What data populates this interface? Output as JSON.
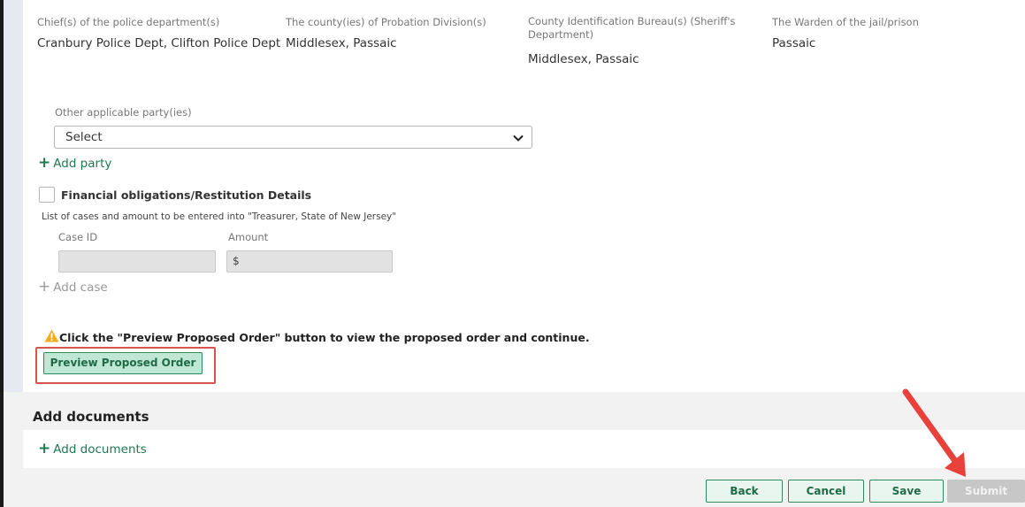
{
  "agencies": [
    {
      "label": "Chief(s) of the police department(s)",
      "value": "Cranbury Police Dept, Clifton Police Dept"
    },
    {
      "label": "The county(ies) of Probation Division(s)",
      "value": "Middlesex, Passaic"
    },
    {
      "label": "County Identification Bureau(s) (Sheriff's Department)",
      "value": "Middlesex, Passaic"
    },
    {
      "label": "The Warden of the jail/prison",
      "value": "Passaic"
    }
  ],
  "other_parties": {
    "label": "Other applicable party(ies)",
    "selected": "Select",
    "add_label": "Add party"
  },
  "financial": {
    "checkbox_label": "Financial obligations/Restitution Details",
    "checked": false,
    "description": "List of cases and amount to be entered into \"Treasurer, State of New Jersey\"",
    "case_id_label": "Case ID",
    "case_id_value": "",
    "amount_label": "Amount",
    "amount_prefix": "$",
    "amount_value": "",
    "add_case_label": "Add case"
  },
  "preview": {
    "instruction": "Click the \"Preview Proposed Order\" button to view the proposed order and continue.",
    "button_label": "Preview Proposed Order"
  },
  "documents": {
    "title": "Add documents",
    "add_label": "Add documents"
  },
  "footer": {
    "back": "Back",
    "cancel": "Cancel",
    "save": "Save",
    "submit": "Submit"
  },
  "icons": {
    "add": "plus-icon",
    "dropdown": "chevron-down-icon",
    "warning": "warning-icon",
    "annotation": "red-arrow-annotation"
  },
  "colors": {
    "accent_green": "#1f7a50",
    "button_fill": "#bfe7d4",
    "highlight_red": "#d9534f",
    "warning_yellow": "#f0ad1e",
    "disabled_gray": "#c7c7c7"
  }
}
